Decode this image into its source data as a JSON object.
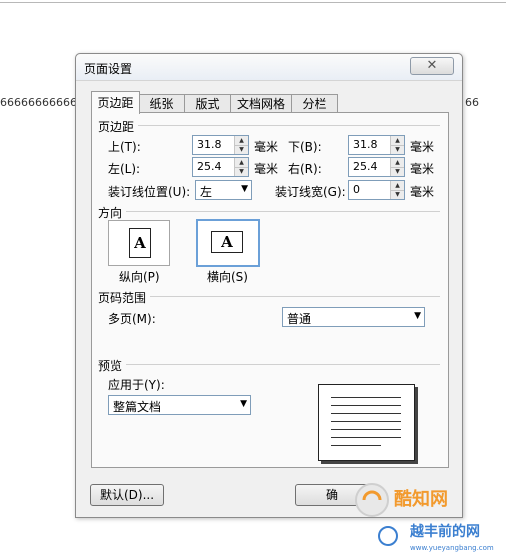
{
  "background": {
    "left_text": "66666666666",
    "right_text": "66"
  },
  "dialog": {
    "title": "页面设置",
    "close_glyph": "✕",
    "tabs": [
      {
        "label": "页边距",
        "active": true
      },
      {
        "label": "纸张",
        "active": false
      },
      {
        "label": "版式",
        "active": false
      },
      {
        "label": "文档网格",
        "active": false
      },
      {
        "label": "分栏",
        "active": false
      }
    ],
    "margins": {
      "section": "页边距",
      "top_label": "上(T):",
      "top_value": "31.8",
      "bottom_label": "下(B):",
      "bottom_value": "31.8",
      "left_label": "左(L):",
      "left_value": "25.4",
      "right_label": "右(R):",
      "right_value": "25.4",
      "unit": "毫米",
      "gutter_pos_label": "装订线位置(U):",
      "gutter_pos_value": "左",
      "gutter_width_label": "装订线宽(G):",
      "gutter_width_value": "0"
    },
    "orientation": {
      "section": "方向",
      "glyph": "A",
      "portrait_label": "纵向(P)",
      "landscape_label": "横向(S)",
      "selected": "landscape"
    },
    "page_range": {
      "section": "页码范围",
      "multiple_label": "多页(M):",
      "multiple_value": "普通"
    },
    "preview": {
      "section": "预览",
      "apply_label": "应用于(Y):",
      "apply_value": "整篇文档"
    },
    "buttons": {
      "default": "默认(D)...",
      "ok": "确"
    }
  },
  "watermark": {
    "line1": "酷知网",
    "line2": "越丰前的网",
    "url": "www.yueyangbang.com"
  },
  "colors": {
    "selection_border": "#6ba0d8",
    "watermark_orange": "#f29a2e",
    "watermark_blue": "#3b7fd0"
  }
}
